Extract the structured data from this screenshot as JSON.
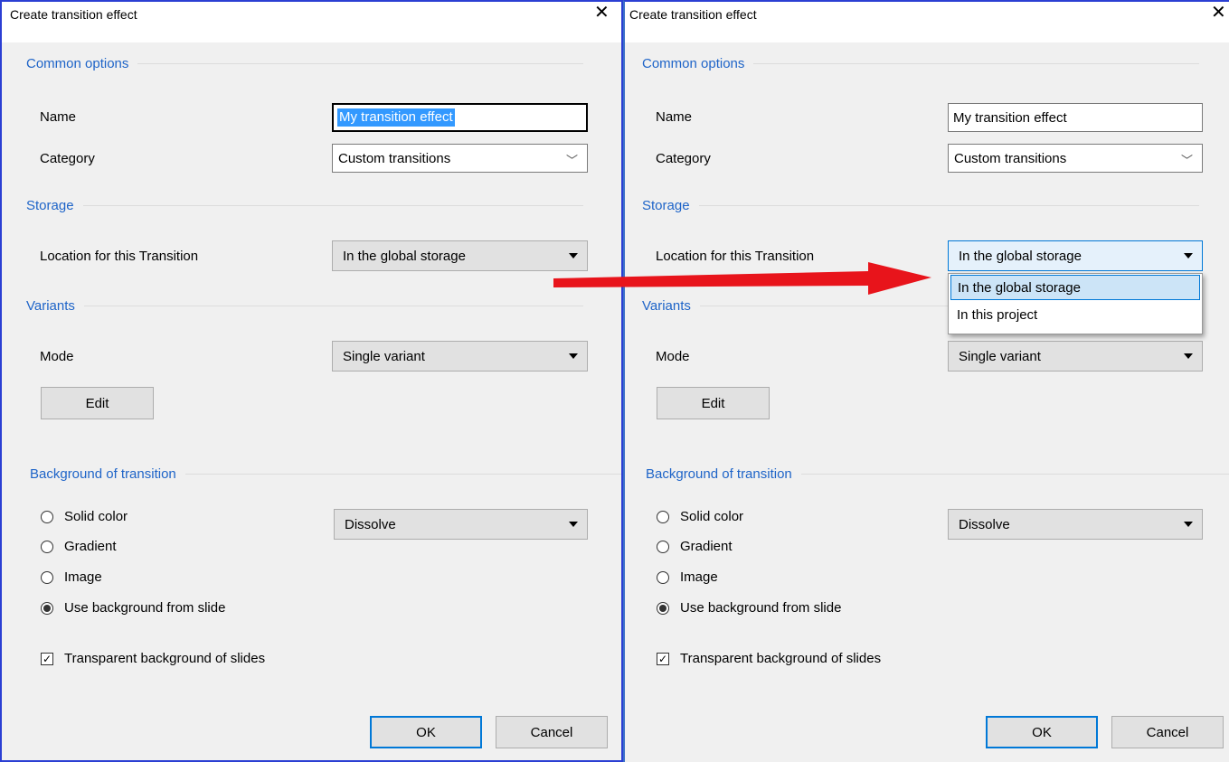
{
  "dialog_title": "Create transition effect",
  "close_glyph": "✕",
  "common_options": {
    "heading": "Common options",
    "name_label": "Name",
    "name_value": "My transition effect",
    "category_label": "Category",
    "category_value": "Custom transitions"
  },
  "storage": {
    "heading": "Storage",
    "location_label": "Location for this Transition",
    "location_value": "In the global storage",
    "options": [
      "In the global storage",
      "In this project"
    ]
  },
  "variants": {
    "heading": "Variants",
    "mode_label": "Mode",
    "mode_value": "Single variant",
    "edit_button": "Edit"
  },
  "background": {
    "heading": "Background of transition",
    "radios": [
      {
        "label": "Solid color",
        "checked": false
      },
      {
        "label": "Gradient",
        "checked": false
      },
      {
        "label": "Image",
        "checked": false
      },
      {
        "label": "Use background from slide",
        "checked": true
      }
    ],
    "effect_value": "Dissolve",
    "transparent_label": "Transparent background of slides",
    "transparent_checked": true
  },
  "buttons": {
    "ok": "OK",
    "cancel": "Cancel"
  },
  "colors": {
    "accent": "#0078d7",
    "group_heading": "#1e64c8",
    "arrow": "#e8141b",
    "frame": "#2b3fd3"
  }
}
